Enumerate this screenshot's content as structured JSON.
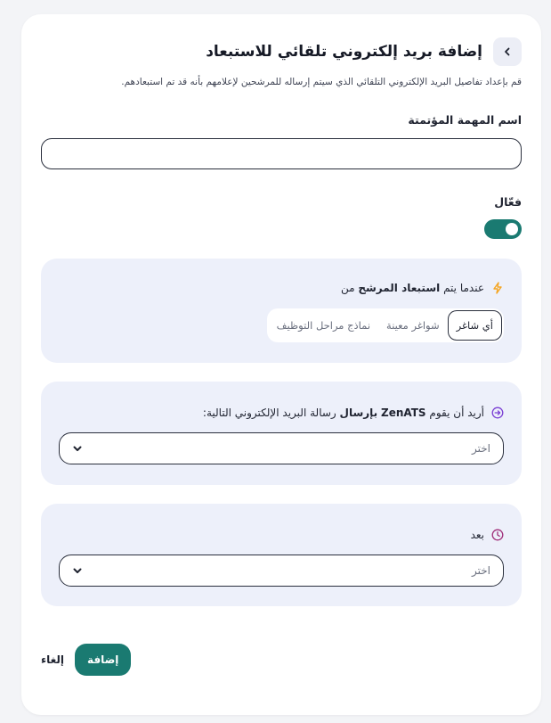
{
  "header": {
    "title": "إضافة بريد إلكتروني تلقائي للاستبعاد",
    "subtitle": "قم بإعداد تفاصيل البريد الإلكتروني التلقائي الذي سيتم إرساله للمرشحين لإعلامهم بأنه قد تم استبعادهم."
  },
  "form": {
    "task_name_label": "اسم المهمة المؤتمتة",
    "task_name_value": "",
    "active_label": "فعّال",
    "active_on": true
  },
  "trigger": {
    "prefix": "عندما يتم",
    "bold": "استبعاد المرشح",
    "suffix": "من",
    "options": [
      "أي شاغر",
      "شواغر معينة",
      "نماذج مراحل التوظيف"
    ],
    "selected": "أي شاغر"
  },
  "send": {
    "prefix": "أريد أن يقوم",
    "brand": "ZenATS",
    "bold": "بإرسال",
    "suffix": "رسالة البريد الإلكتروني التالية:",
    "select_value": "اختر"
  },
  "after": {
    "label": "بعد",
    "select_value": "اختر"
  },
  "actions": {
    "add_label": "إضافة",
    "cancel_label": "إلغاء"
  },
  "colors": {
    "accent": "#1a7a71",
    "panel": "#edf0fa",
    "bolt": "#f5a623",
    "arrow": "#7b3fd4",
    "clock": "#a0307a"
  }
}
